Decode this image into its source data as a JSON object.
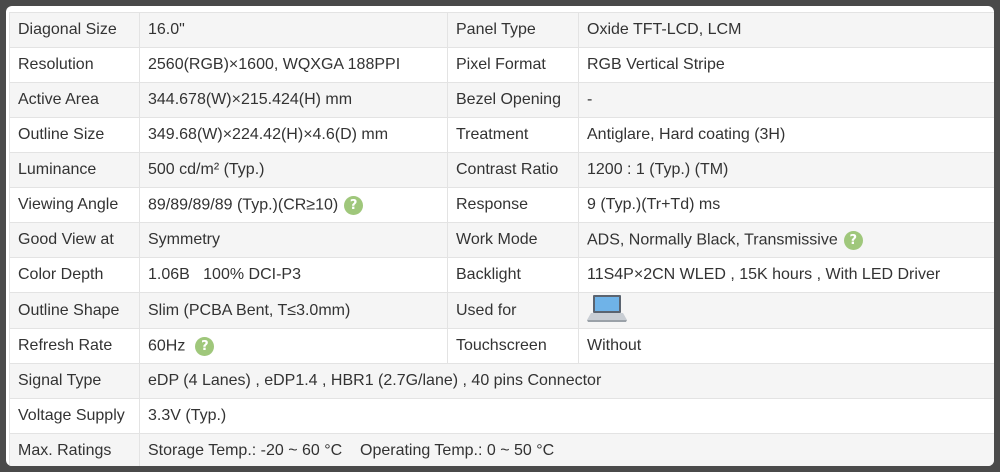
{
  "rows": [
    {
      "l1": "Diagonal Size",
      "v1": "16.0\"",
      "l2": "Panel Type",
      "v2": "Oxide TFT-LCD, LCM"
    },
    {
      "l1": "Resolution",
      "v1": "2560(RGB)×1600, WQXGA  188PPI",
      "l2": "Pixel Format",
      "v2": "RGB Vertical Stripe"
    },
    {
      "l1": "Active Area",
      "v1": "344.678(W)×215.424(H) mm",
      "l2": "Bezel Opening",
      "v2": "-"
    },
    {
      "l1": "Outline Size",
      "v1": "349.68(W)×224.42(H)×4.6(D) mm",
      "l2": "Treatment",
      "v2": "Antiglare, Hard coating (3H)"
    },
    {
      "l1": "Luminance",
      "v1": "500 cd/m² (Typ.)",
      "l2": "Contrast Ratio",
      "v2": "1200 : 1 (Typ.) (TM)"
    },
    {
      "l1": "Viewing Angle",
      "v1": "89/89/89/89 (Typ.)(CR≥10)",
      "l2": "Response",
      "v2": "9 (Typ.)(Tr+Td) ms"
    },
    {
      "l1": "Good View at",
      "v1": "Symmetry",
      "l2": "Work Mode",
      "v2": "ADS, Normally Black, Transmissive"
    },
    {
      "l1": "Color Depth",
      "v1": "1.06B   100% DCI-P3",
      "l2": "Backlight",
      "v2": "11S4P×2CN WLED , 15K hours , With LED Driver"
    },
    {
      "l1": "Outline Shape",
      "v1": "Slim (PCBA Bent, T≤3.0mm)",
      "l2": "Used for",
      "v2": ""
    },
    {
      "l1": "Refresh Rate",
      "v1": "60Hz",
      "l2": "Touchscreen",
      "v2": "Without"
    },
    {
      "l1": "Signal Type",
      "v1": "eDP (4 Lanes) , eDP1.4 , HBR1 (2.7G/lane) , 40 pins Connector"
    },
    {
      "l1": "Voltage Supply",
      "v1": "3.3V (Typ.)"
    },
    {
      "l1": "Max. Ratings",
      "v1": "Storage Temp.: -20 ~ 60 °C    Operating Temp.: 0 ~ 50 °C"
    }
  ],
  "help_glyph": "?",
  "icons": {
    "help": "question-circle-icon",
    "used_for": "laptop-icon"
  },
  "colors": {
    "help_badge": "#9fc77b",
    "row_alt": "#f5f5f5",
    "border": "#e3e3e3"
  }
}
